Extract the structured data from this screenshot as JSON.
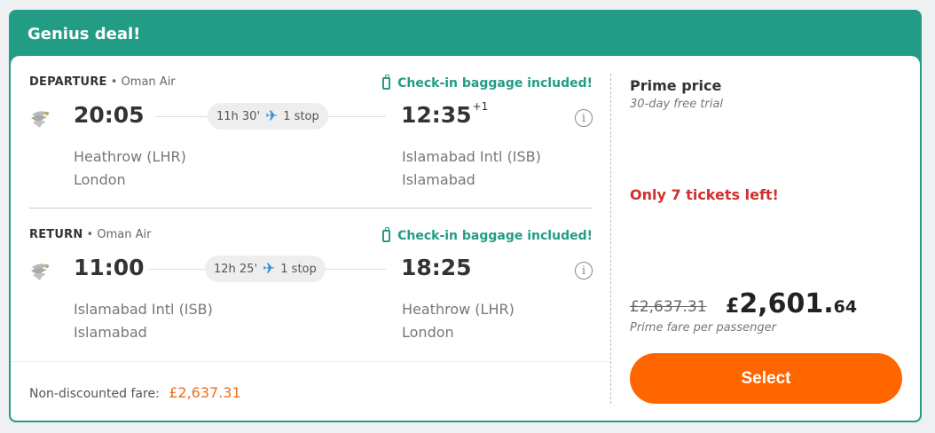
{
  "header": {
    "title": "Genius deal!"
  },
  "legs": [
    {
      "kind": "DEPARTURE",
      "airline": "Oman Air",
      "baggage": "Check-in baggage included!",
      "depart_time": "20:05",
      "arrive_time": "12:35",
      "arrive_day_offset": "+1",
      "duration": "11h 30'",
      "stops": "1 stop",
      "origin_airport": "Heathrow (LHR)",
      "origin_city": "London",
      "dest_airport": "Islamabad Intl (ISB)",
      "dest_city": "Islamabad",
      "info_glyph": "i"
    },
    {
      "kind": "RETURN",
      "airline": "Oman Air",
      "baggage": "Check-in baggage included!",
      "depart_time": "11:00",
      "arrive_time": "18:25",
      "duration": "12h 25'",
      "stops": "1 stop",
      "origin_airport": "Islamabad Intl (ISB)",
      "origin_city": "Islamabad",
      "dest_airport": "Heathrow (LHR)",
      "dest_city": "London",
      "info_glyph": "i"
    }
  ],
  "label_separator": "•",
  "plane_glyph": "✈",
  "non_discounted": {
    "label": "Non-discounted fare:",
    "amount": "£2,637.31"
  },
  "pricing": {
    "title": "Prime price",
    "subtitle": "30-day free trial",
    "tickets_left": "Only 7 tickets left!",
    "old_price": "£2,637.31",
    "currency": "£",
    "new_price_main": "2,601.",
    "new_price_decimals": "64",
    "fare_note": "Prime fare per passenger",
    "select_label": "Select"
  },
  "colors": {
    "brand_green": "#239c86",
    "cta_orange": "#ff6600",
    "alert_red": "#d32f2f",
    "plane_blue": "#2a8bd6"
  },
  "icons": [
    "luggage-icon",
    "airline-logo-icon",
    "plane-icon",
    "info-icon"
  ]
}
